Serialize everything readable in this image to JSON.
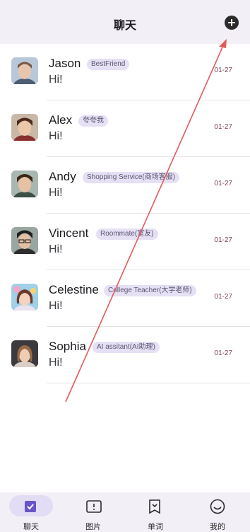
{
  "header": {
    "title": "聊天"
  },
  "chats": [
    {
      "name": "Jason",
      "tag": "BestFriend",
      "message": "Hi!",
      "date": "01-27"
    },
    {
      "name": "Alex",
      "tag": "夸夸我",
      "message": "Hi!",
      "date": "01-27"
    },
    {
      "name": "Andy",
      "tag": "Shopping Service(商场客服)",
      "message": "Hi!",
      "date": "01-27"
    },
    {
      "name": "Vincent",
      "tag": "Roommate(室友)",
      "message": "Hi!",
      "date": "01-27"
    },
    {
      "name": "Celestine",
      "tag": "College Teacher(大学老师)",
      "message": "Hi!",
      "date": "01-27"
    },
    {
      "name": "Sophia",
      "tag": "AI assitant(AI助理)",
      "message": "Hi!",
      "date": "01-27"
    }
  ],
  "nav": [
    {
      "label": "聊天",
      "icon": "chat-check-icon",
      "active": true
    },
    {
      "label": "图片",
      "icon": "image-book-icon",
      "active": false
    },
    {
      "label": "单词",
      "icon": "word-book-icon",
      "active": false
    },
    {
      "label": "我的",
      "icon": "smile-profile-icon",
      "active": false
    }
  ],
  "colors": {
    "header_bg": "#f2eff6",
    "badge_bg": "#e6e0f5",
    "date": "#7a4250",
    "nav_active_pill": "#e3dcf5",
    "accent": "#6a55c8",
    "annotation_arrow": "#e45a5a"
  }
}
